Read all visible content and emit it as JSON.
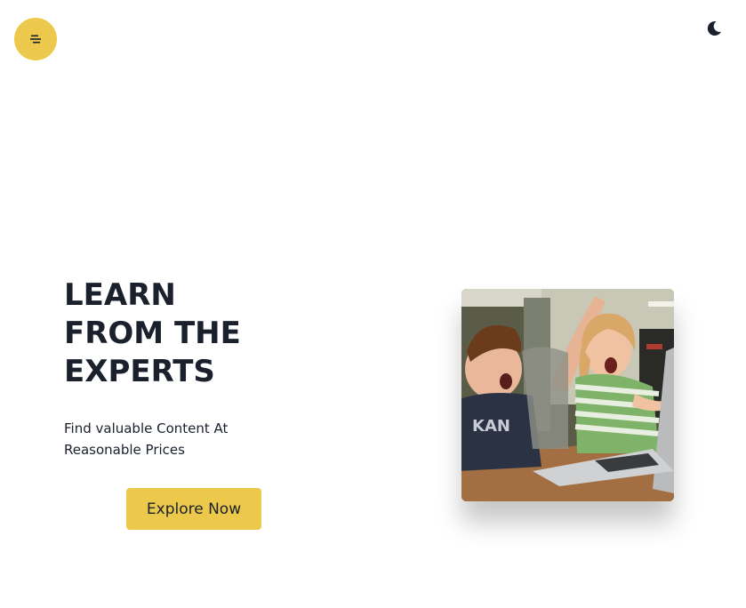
{
  "header": {
    "menu_icon": "hamburger-icon",
    "theme_icon": "moon-icon",
    "accent_color": "#ecc94b"
  },
  "hero": {
    "title_lines": [
      "LEARN",
      "FROM THE",
      "EXPERTS"
    ],
    "subtitle_lines": [
      "Find valuable Content At",
      "Reasonable Prices"
    ],
    "cta_label": "Explore Now",
    "image_alt": "Two excited children looking at a laptop"
  }
}
